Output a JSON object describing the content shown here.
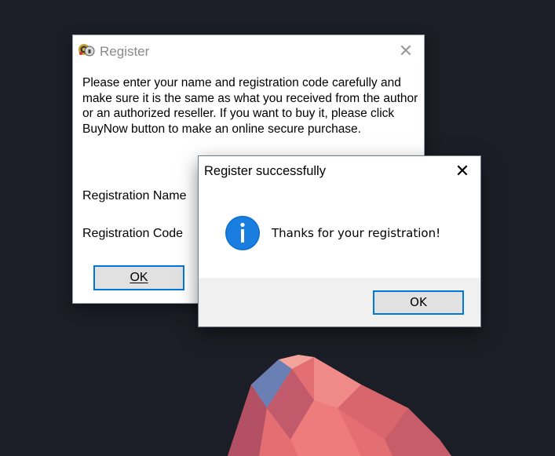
{
  "register_window": {
    "title": "Register",
    "close_glyph": "✕",
    "message": "Please enter your name and registration code carefully and make sure it is the same as what you received from the author or an authorized reseller. If you want to buy it, please click BuyNow button to make an online secure purchase.",
    "name_label": "Registration Name",
    "code_label": "Registration Code",
    "ok_label": "OK",
    "app_icon": "key-lock-icon"
  },
  "message_box": {
    "title": "Register successfully",
    "close_glyph": "✕",
    "icon": "info-icon",
    "text": "Thanks for your registration!",
    "ok_label": "OK"
  },
  "colors": {
    "accent": "#0078d7",
    "desktop_bg": "#1c1e27",
    "mountain": "#e46f72"
  }
}
